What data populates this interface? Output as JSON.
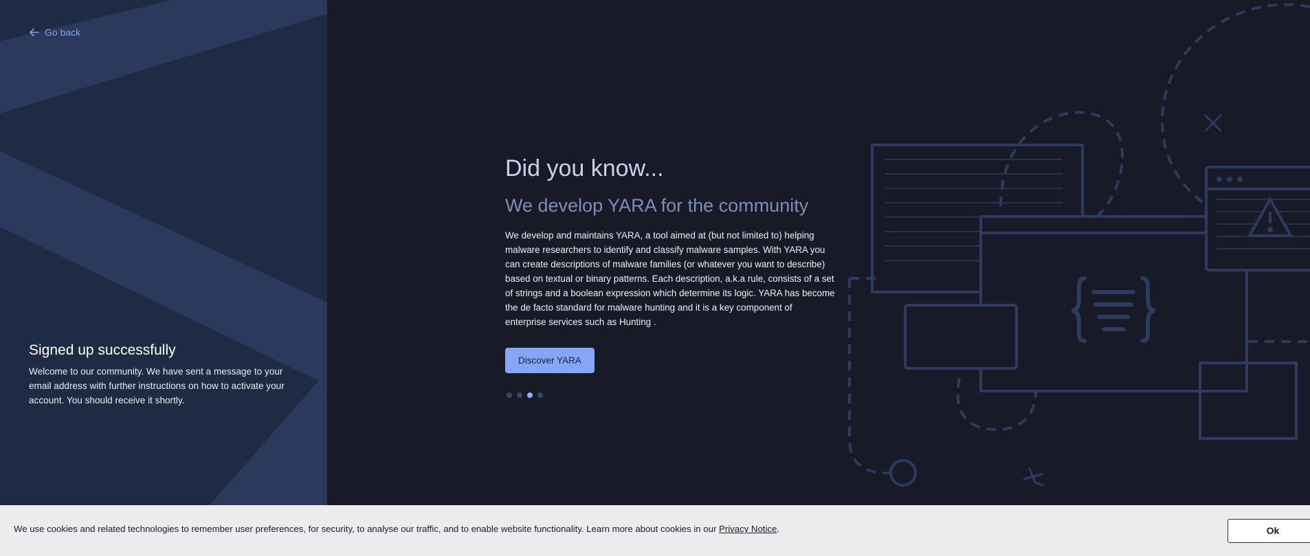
{
  "nav": {
    "go_back_label": "Go back"
  },
  "signup": {
    "title": "Signed up successfully",
    "message": "Welcome to our community. We have sent a message to your email address with further instructions on how to activate your account. You should receive it shortly."
  },
  "carousel": {
    "heading": "Did you know...",
    "subheading": "We develop YARA for the community",
    "body": "We develop and maintains YARA, a tool aimed at (but not limited to) helping malware researchers to identify and classify malware samples. With YARA you can create descriptions of malware families (or whatever you want to describe) based on textual or binary patterns. Each description, a.k.a rule, consists of a set of strings and a boolean expression which determine its logic. YARA has become the de facto standard for malware hunting and it is a key component of enterprise services such as Hunting .",
    "button_label": "Discover YARA",
    "active_slide": 3,
    "total_slides": 4
  },
  "cookie_banner": {
    "text": "We use cookies and related technologies to remember user preferences, for security, to analyse our traffic, and to enable website functionality. Learn more about cookies in our",
    "link_label": "Privacy Notice",
    "suffix": ".",
    "ok_label": "Ok"
  },
  "colors": {
    "left_panel_bg": "#1f2a44",
    "main_bg": "#181a27",
    "accent": "#86a6f5",
    "link": "#7fa3f3",
    "illustration_stroke": "#2c3b5e"
  },
  "icons": {
    "back": "arrow-left-icon",
    "warning": "warning-icon",
    "braces": "curly-braces-icon"
  }
}
